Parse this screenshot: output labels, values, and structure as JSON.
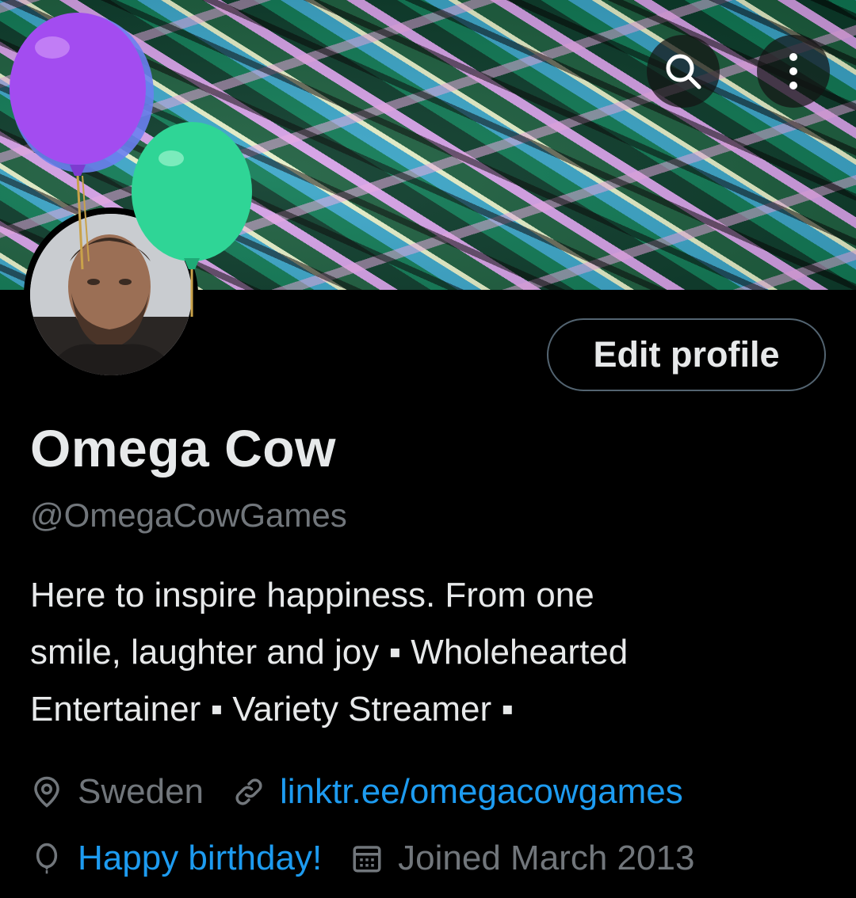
{
  "header": {
    "search_icon": "search-icon",
    "more_icon": "more-vertical-icon"
  },
  "profile": {
    "name": "Omega Cow",
    "handle": "@OmegaCowGames",
    "edit_button_label": "Edit profile",
    "bio_lines": [
      "Here to inspire happiness. From one",
      "smile, laughter and joy ▪  Wholehearted",
      "Entertainer  ▪ Variety Streamer ▪"
    ],
    "location": "Sweden",
    "website": "linktr.ee/omegacowgames",
    "birthday": "Happy birthday!",
    "joined": "Joined March 2013"
  },
  "colors": {
    "background": "#000000",
    "text_primary": "#e7e9ea",
    "text_secondary": "#71767b",
    "link": "#1d9bf0",
    "button_border": "#536471",
    "balloon_purple": "#a34cf0",
    "balloon_green": "#2fd596"
  }
}
